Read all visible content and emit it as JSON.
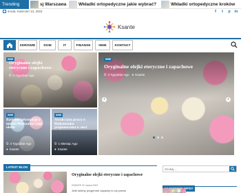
{
  "trending": {
    "label": "Trending News",
    "items": [
      {
        "text": "sj Warszawa"
      },
      {
        "text": "Wkładki ortopedyczne jakie wybrać?"
      },
      {
        "text": "Wkładki ortopedyczne kroków"
      }
    ]
  },
  "header": {
    "date": "środa, Kwiecień 13, 2022",
    "social": [
      "f",
      "t",
      "p",
      "in"
    ]
  },
  "logo": {
    "text": "Ksante"
  },
  "nav": {
    "items": [
      "ZDROWIE",
      "DOM",
      "IT",
      "FINANSE",
      "INNE",
      "KONTAKT"
    ]
  },
  "slider": {
    "left_top": {
      "badge": "INNE",
      "title": "Oryginalne olejki eteryczne i zapachowe",
      "time": "3 Tygodnie Ago",
      "author": "Ksante"
    },
    "main": {
      "badge": "INNE",
      "title": "Oryginalne olejki eteryczne i zapachowe",
      "time": "3 Tygodnie Ago",
      "author": "Ksante"
    },
    "small_left": {
      "badge": "INNE",
      "title": "Rzetelne informacje z miasta Warszawa i jego okolic",
      "time": "4 Tygodnie Ago",
      "author": "Ksante"
    },
    "small_right": {
      "badge": "INNE",
      "title": "Atrakcyjna praca w Białymstoku proponowana w sieci",
      "time": "1 Miesiąc Ago",
      "author": "Ksante"
    },
    "prev": "‹",
    "next": "›"
  },
  "latest": {
    "title": "LATEST BLOG",
    "post": {
      "title": "Oryginalne olejki eteryczne i zapachowe",
      "meta": "KSANTE 22 marca 2022",
      "excerpt": "Jeśli lubimy przyjemne zapachy to na pewno"
    }
  },
  "sidebar": {
    "search_placeholder": "Szukaj ...",
    "popular_title": "NAJNOWSZE WPISY"
  },
  "colors": {
    "accent": "#1d6fa5"
  }
}
